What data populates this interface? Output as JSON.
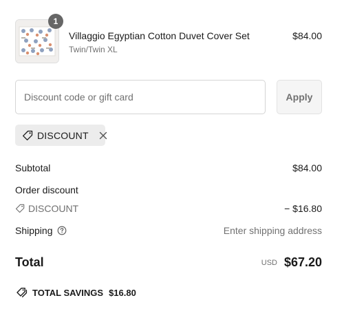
{
  "line_item": {
    "quantity": "1",
    "title": "Villaggio Egyptian Cotton Duvet Cover Set",
    "variant": "Twin/Twin XL",
    "price": "$84.00"
  },
  "discount_form": {
    "placeholder": "Discount code or gift card",
    "value": "",
    "apply_label": "Apply"
  },
  "applied_discount": {
    "code": "DISCOUNT"
  },
  "summary": {
    "subtotal_label": "Subtotal",
    "subtotal_value": "$84.00",
    "order_discount_label": "Order discount",
    "discount_code": "DISCOUNT",
    "discount_value": "− $16.80",
    "shipping_label": "Shipping",
    "shipping_value": "Enter shipping address",
    "total_label": "Total",
    "currency": "USD",
    "total_value": "$67.20",
    "savings_label": "TOTAL SAVINGS",
    "savings_value": "$16.80"
  },
  "icons": {
    "discount_tag": "tag-icon",
    "remove": "close-icon",
    "shipping_help": "question-circle-icon",
    "savings": "tags-icon"
  },
  "colors": {
    "text": "#1a1a1a",
    "muted": "#707070",
    "badge": "#666666",
    "tag_background": "#ececec",
    "button_background": "#f5f5f5",
    "border": "#d4d4d4"
  }
}
